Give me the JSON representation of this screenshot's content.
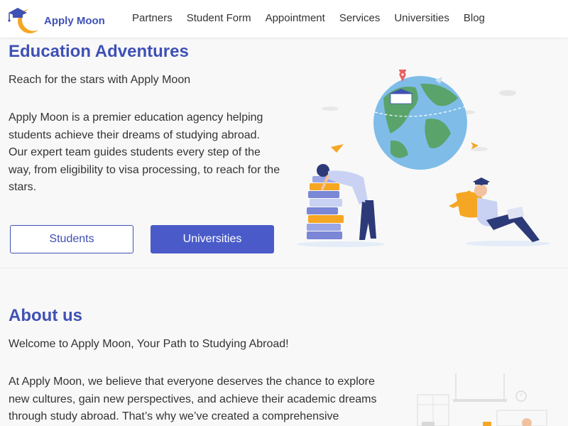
{
  "brand": {
    "name": "Apply Moon",
    "logo_icon": "moon-graduation-cap-icon"
  },
  "nav": {
    "items": [
      {
        "label": "Partners"
      },
      {
        "label": "Student Form"
      },
      {
        "label": "Appointment"
      },
      {
        "label": "Services"
      },
      {
        "label": "Universities"
      },
      {
        "label": "Blog"
      }
    ]
  },
  "hero": {
    "title": "Education Adventures",
    "tagline": "Reach for the stars with Apply Moon",
    "description": "Apply Moon is a premier education agency helping students achieve their dreams of studying abroad. Our expert team guides students every step of the way, from eligibility to visa processing, to reach for the stars.",
    "buttons": {
      "students": "Students",
      "universities": "Universities"
    },
    "illustration_icon": "globe-students-illustration"
  },
  "about": {
    "title": "About us",
    "welcome": "Welcome to Apply Moon, Your Path to Studying Abroad!",
    "description": "At Apply Moon, we believe that everyone deserves the chance to explore new cultures, gain new perspectives, and achieve their academic dreams through study abroad. That’s why we’ve created a comprehensive",
    "illustration_icon": "office-illustration"
  },
  "colors": {
    "brand": "#3f51b5",
    "button": "#4a5bc9",
    "moon": "#f5a623",
    "background": "#f8f8f8"
  }
}
